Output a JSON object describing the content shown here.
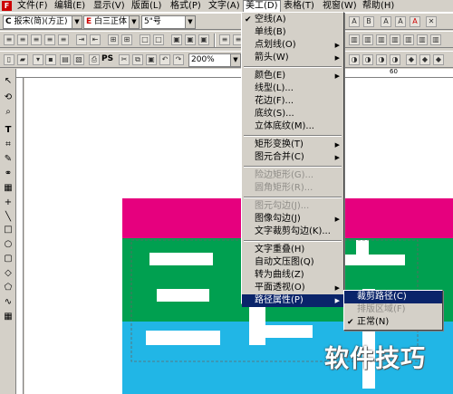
{
  "menubar": {
    "items": [
      {
        "label": "文件(F)"
      },
      {
        "label": "编辑(E)"
      },
      {
        "label": "显示(V)"
      },
      {
        "label": "版面(L)"
      },
      {
        "label": "格式(P)"
      },
      {
        "label": "文字(A)"
      },
      {
        "label": "美工(D)"
      },
      {
        "label": "表格(T)"
      },
      {
        "label": "视窗(W)"
      },
      {
        "label": "帮助(H)"
      }
    ]
  },
  "toolbar1": {
    "font_mode": "C",
    "font_name": "报宋(简)(方正)",
    "font_mode2": "E",
    "font_name2": "白三正体",
    "font_size": "5\"号"
  },
  "toolbar3": {
    "zoom": "200%",
    "ps_label": "PS"
  },
  "ruler": {
    "marks": [
      "60"
    ]
  },
  "art_menu": {
    "items": [
      {
        "label": "空线(A)",
        "checked": true
      },
      {
        "label": "单线(B)"
      },
      {
        "label": "点划线(O)",
        "submenu": true
      },
      {
        "label": "箭头(W)",
        "submenu": true
      },
      {
        "label": "颜色(E)",
        "submenu": true
      },
      {
        "label": "线型(L)..."
      },
      {
        "label": "花边(F)..."
      },
      {
        "label": "底纹(S)..."
      },
      {
        "label": "立体底纹(M)..."
      },
      {
        "label": "矩形变换(T)",
        "submenu": true
      },
      {
        "label": "图元合并(C)",
        "submenu": true
      },
      {
        "label": "险边矩形(G)...",
        "disabled": true
      },
      {
        "label": "圆角矩形(R)...",
        "disabled": true
      },
      {
        "label": "图元勾边(J)...",
        "disabled": true
      },
      {
        "label": "图像勾边(J)",
        "submenu": true
      },
      {
        "label": "文字裁剪勾边(K)..."
      },
      {
        "label": "文字重叠(H)"
      },
      {
        "label": "自动文压图(Q)"
      },
      {
        "label": "转为曲线(Z)"
      },
      {
        "label": "平面透视(O)",
        "submenu": true
      },
      {
        "label": "路径属性(P)",
        "submenu": true,
        "highlighted": true
      }
    ]
  },
  "path_submenu": {
    "items": [
      {
        "label": "裁剪路径(C)",
        "highlighted": true
      },
      {
        "label": "排版区域(F)",
        "disabled": true
      },
      {
        "label": "正常(N)",
        "checked": true
      }
    ]
  },
  "watermark": "软件技巧",
  "colors": {
    "magenta": "#e6007e",
    "green": "#00a050",
    "cyan": "#21b6e6",
    "menu_highlight": "#0a246a"
  }
}
